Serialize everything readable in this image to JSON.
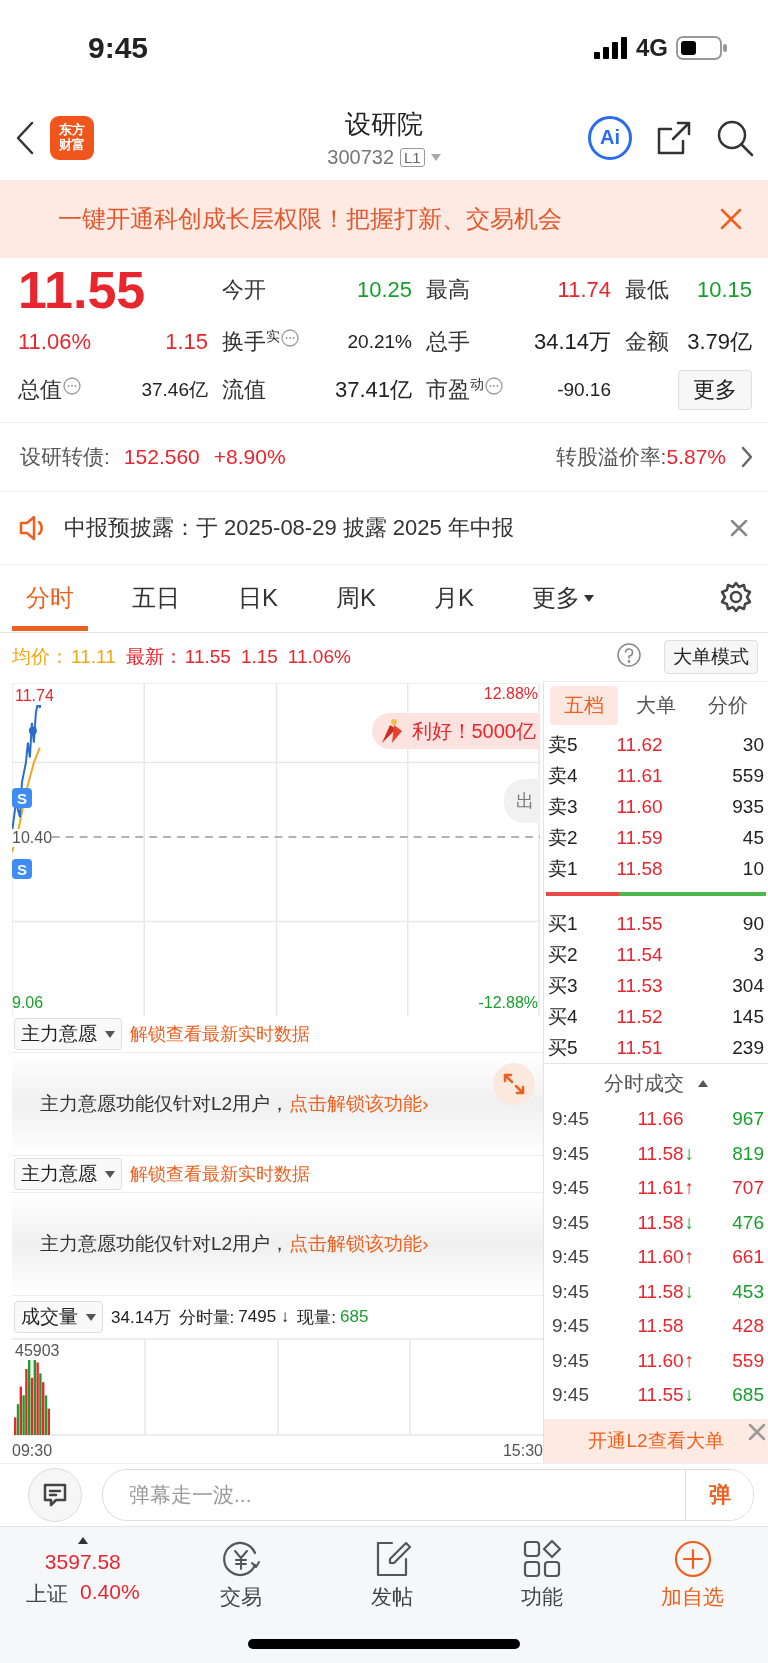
{
  "status_bar": {
    "time": "9:45",
    "network": "4G"
  },
  "header": {
    "logo": [
      "东方",
      "财富"
    ],
    "title": "设研院",
    "code": "300732",
    "level_badge": "L1",
    "ai_button": "Ai"
  },
  "banner": {
    "text": "一键开通科创成长层权限！把握打新、交易机会"
  },
  "quote": {
    "price": "11.55",
    "change_pct": "11.06%",
    "change": "1.15",
    "more_button": "更多",
    "stats": [
      {
        "label": "今开",
        "value": "10.25",
        "color": "#17a02b",
        "info": false
      },
      {
        "label": "最高",
        "value": "11.74",
        "color": "#e8262d",
        "info": false
      },
      {
        "label": "最低",
        "value": "10.15",
        "color": "#17a02b",
        "info": false
      },
      {
        "label": "换手",
        "sup": "实",
        "value": "20.21%",
        "color": "#222222",
        "info": true
      },
      {
        "label": "总手",
        "value": "34.14万",
        "color": "#222222",
        "info": false
      },
      {
        "label": "金额",
        "value": "3.79亿",
        "color": "#222222",
        "info": false
      },
      {
        "label": "总值",
        "value": "37.46亿",
        "color": "#222222",
        "info": true
      },
      {
        "label": "流值",
        "value": "37.41亿",
        "color": "#222222",
        "info": false
      },
      {
        "label": "市盈",
        "sup": "动",
        "value": "-90.16",
        "color": "#222222",
        "info": true
      }
    ]
  },
  "bond": {
    "label": "设研转债:",
    "price": "152.560",
    "change": "+8.90%",
    "premium_label": "转股溢价率:",
    "premium": "5.87%"
  },
  "notice": {
    "text": "中报预披露：于 2025-08-29 披露 2025 年中报"
  },
  "chart_tabs": [
    {
      "label": "分时",
      "selected": true,
      "kind": "tab"
    },
    {
      "label": "五日",
      "selected": false,
      "kind": "tab"
    },
    {
      "label": "日K",
      "selected": false,
      "kind": "tab"
    },
    {
      "label": "周K",
      "selected": false,
      "kind": "tab"
    },
    {
      "label": "月K",
      "selected": false,
      "kind": "tab"
    },
    {
      "label": "更多",
      "selected": false,
      "kind": "menu"
    }
  ],
  "chart_info": {
    "avg_label": "均价：",
    "avg": "11.11",
    "latest_label": "最新：",
    "latest": "11.55",
    "change": "1.15",
    "change_pct": "11.06%",
    "mode_button": "大单模式"
  },
  "price_chart": {
    "high": "11.74",
    "mid": "10.40",
    "low": "9.06",
    "high_pct": "12.88%",
    "low_pct": "-12.88%",
    "news_pill": "利好！5000亿",
    "side_button": "出",
    "markers": [
      {
        "label": "S"
      },
      {
        "label": "S"
      }
    ]
  },
  "order_book": {
    "tabs": [
      {
        "label": "五档",
        "selected": true
      },
      {
        "label": "大单",
        "selected": false
      },
      {
        "label": "分价",
        "selected": false
      }
    ],
    "asks": [
      {
        "label": "卖5",
        "price": "11.62",
        "volume": "30"
      },
      {
        "label": "卖4",
        "price": "11.61",
        "volume": "559"
      },
      {
        "label": "卖3",
        "price": "11.60",
        "volume": "935"
      },
      {
        "label": "卖2",
        "price": "11.59",
        "volume": "45"
      },
      {
        "label": "卖1",
        "price": "11.58",
        "volume": "10"
      }
    ],
    "bids": [
      {
        "label": "买1",
        "price": "11.55",
        "volume": "90"
      },
      {
        "label": "买2",
        "price": "11.54",
        "volume": "3"
      },
      {
        "label": "买3",
        "price": "11.53",
        "volume": "304"
      },
      {
        "label": "买4",
        "price": "11.52",
        "volume": "145"
      },
      {
        "label": "买5",
        "price": "11.51",
        "volume": "239"
      }
    ],
    "trades_title": "分时成交",
    "trades": [
      {
        "time": "9:45",
        "price": "11.66",
        "volume": "967",
        "color": "#17a02b"
      },
      {
        "time": "9:45",
        "price": "11.58",
        "arrow": "↓",
        "volume": "819",
        "color": "#17a02b"
      },
      {
        "time": "9:45",
        "price": "11.61",
        "arrow": "↑",
        "volume": "707",
        "color": "#e8262d"
      },
      {
        "time": "9:45",
        "price": "11.58",
        "arrow": "↓",
        "volume": "476",
        "color": "#17a02b"
      },
      {
        "time": "9:45",
        "price": "11.60",
        "arrow": "↑",
        "volume": "661",
        "color": "#e8262d"
      },
      {
        "time": "9:45",
        "price": "11.58",
        "arrow": "↓",
        "volume": "453",
        "color": "#17a02b"
      },
      {
        "time": "9:45",
        "price": "11.58",
        "volume": "428",
        "color": "#e8262d"
      },
      {
        "time": "9:45",
        "price": "11.60",
        "arrow": "↑",
        "volume": "559",
        "color": "#e8262d"
      },
      {
        "time": "9:45",
        "price": "11.55",
        "arrow": "↓",
        "volume": "685",
        "color": "#17a02b"
      }
    ],
    "footer": "开通L2查看大单"
  },
  "indicators": [
    {
      "selector": "主力意愿",
      "unlock_link": "解锁查看最新实时数据",
      "message": "主力意愿功能仅针对L2用户，",
      "action": "点击解锁该功能›",
      "expand": true
    },
    {
      "selector": "主力意愿",
      "unlock_link": "解锁查看最新实时数据",
      "message": "主力意愿功能仅针对L2用户，",
      "action": "点击解锁该功能›",
      "expand": false
    }
  ],
  "volume": {
    "selector": "成交量",
    "total": "34.14万",
    "minute_label": "分时量:",
    "minute": "7495 ↓",
    "current_label": "现量:",
    "current": "685",
    "max": "45903",
    "start": "09:30",
    "end": "15:30"
  },
  "danmu": {
    "placeholder": "弹幕走一波...",
    "send": "弹"
  },
  "bottom_nav": {
    "index": {
      "value": "3597.58",
      "name": "上证",
      "change": "0.40%"
    },
    "items": [
      {
        "label": "交易",
        "kind": "trade",
        "highlight": false
      },
      {
        "label": "发帖",
        "kind": "post",
        "highlight": false
      },
      {
        "label": "功能",
        "kind": "apps",
        "highlight": false
      },
      {
        "label": "加自选",
        "kind": "add",
        "highlight": true
      }
    ]
  }
}
